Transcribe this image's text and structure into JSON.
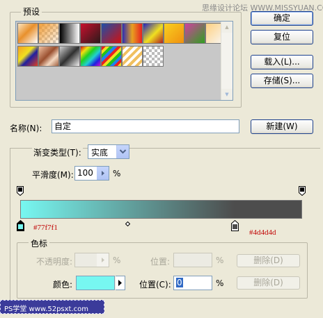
{
  "watermark_top": "思缘设计论坛 WWW.MISSYUAN.COM",
  "presets": {
    "title": "预设",
    "swatches": [
      "linear-gradient(135deg,#fbe5c0,#e8902c 45%,#fff 100%)",
      "checker-orange",
      "linear-gradient(90deg,#000,#fff)",
      "linear-gradient(135deg,#c8102e,#2a1a1a)",
      "linear-gradient(135deg,#1e4fa8,#d01010)",
      "linear-gradient(90deg,#2d2db4,#e8a020,#e82020)",
      "linear-gradient(135deg,#2020c0,#f0e020 55%,#b02020)",
      "linear-gradient(135deg,#f8d020,#f09010)",
      "linear-gradient(135deg,#d040a0,#30a020)",
      "linear-gradient(135deg,#ffd080,#f8f8f8)",
      "linear-gradient(135deg,#f4a020,#f0e020 40%,#2020a0 60%,#e04020)",
      "linear-gradient(135deg,#f0c0a0,#9a5030 45%,#f4d8c0 70%,#a06040)",
      "linear-gradient(135deg,#d0d0d0,#303030 50%,#f0f0f0)",
      "linear-gradient(135deg,#d01010,#f0e010 20%,#20d020 40%,#20d0d0 60%,#2020e0 80%,#d010d0)",
      "repeating-linear-gradient(135deg,#e82020 0 4px,#f0e020 4px 8px,#20c020 8px 12px,#2080f0 12px 16px)",
      "stripes-gold",
      "checker-gray"
    ],
    "scroll_up": "▲",
    "scroll_down": "▼"
  },
  "buttons": {
    "ok": "确定",
    "reset": "复位",
    "load": "载入(L)...",
    "save": "存储(S)...",
    "new": "新建(W)"
  },
  "name": {
    "label": "名称(N):",
    "value": "自定"
  },
  "gradient_type": {
    "label": "渐变类型(T):",
    "value": "实底"
  },
  "smoothness": {
    "label": "平滑度(M):",
    "value": "100",
    "unit": "%"
  },
  "gradient": {
    "start_color": "#77f7f1",
    "end_color": "#4d4d4d",
    "start_label": "#77f7f1",
    "end_label": "#4d4d4d",
    "end_stop_location_percent": 76,
    "midpoint_percent": 50
  },
  "color_stops": {
    "title": "色标",
    "opacity_label": "不透明度:",
    "opacity_unit": "%",
    "opacity_location_label": "位置:",
    "opacity_location_unit": "%",
    "opacity_delete": "删除(D)",
    "color_label": "颜色:",
    "color_swatch": "#77f7f1",
    "location_label": "位置(C):",
    "location_value": "0",
    "location_unit": "%",
    "color_delete": "删除(D)"
  },
  "footer_watermark": "PS学堂  www.52psxt.com"
}
